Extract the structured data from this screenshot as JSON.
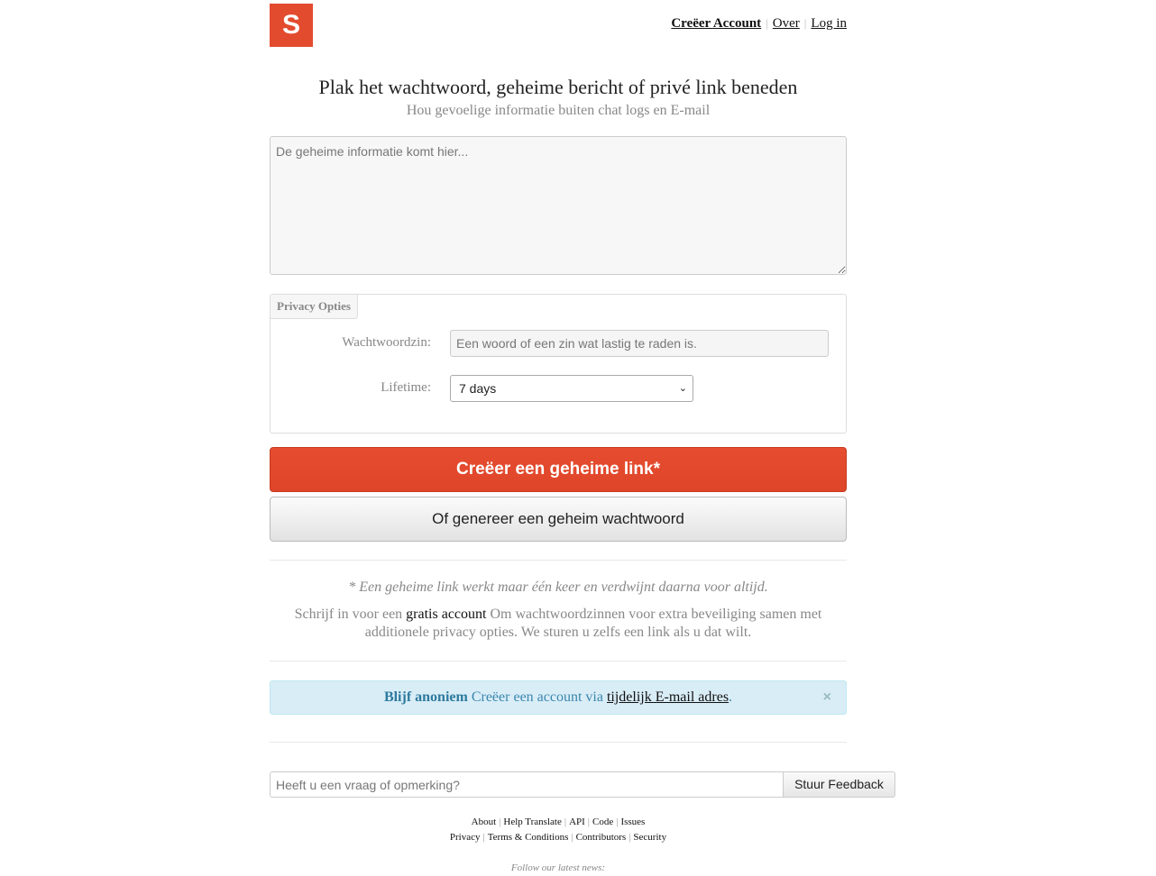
{
  "brand": {
    "logo_letter": "S"
  },
  "topnav": {
    "create_account": "Creëer Account",
    "about": "Over",
    "login": "Log in",
    "separator": "|"
  },
  "hero": {
    "title": "Plak het wachtwoord, geheime bericht of privé link beneden",
    "subtitle": "Hou gevoelige informatie buiten chat logs en E-mail"
  },
  "secret_field": {
    "placeholder": "De geheime informatie komt hier..."
  },
  "privacy_options": {
    "tab_label": "Privacy Opties",
    "passphrase_label": "Wachtwoordzin:",
    "passphrase_placeholder": "Een woord of een zin wat lastig te raden is.",
    "lifetime_label": "Lifetime:",
    "lifetime_value": "7 days"
  },
  "actions": {
    "create_link": "Creëer een geheime link*",
    "generate_password": "Of genereer een geheim wachtwoord"
  },
  "notes": {
    "one_time": "* Een geheime link werkt maar één keer en verdwijnt daarna voor altijd.",
    "signup_prefix": "Schrijf in voor een ",
    "signup_link": "gratis account",
    "signup_suffix": " Om wachtwoordzinnen voor extra beveiliging samen met additionele privacy opties. We sturen u zelfs een link als u dat wilt."
  },
  "alert": {
    "strong": "Blijf anoniem",
    "text": " Creëer een account via ",
    "link": "tijdelijk E-mail adres",
    "end": ".",
    "close": "×"
  },
  "feedback": {
    "placeholder": "Heeft u een vraag of opmerking?",
    "button": "Stuur Feedback"
  },
  "footer": {
    "row1": [
      "About",
      "Help Translate",
      "API",
      "Code",
      "Issues"
    ],
    "row2": [
      "Privacy",
      "Terms & Conditions",
      "Contributors",
      "Security"
    ],
    "follow": "Follow our latest news:"
  },
  "colors": {
    "brand": "#e34b2f",
    "alert_bg": "#d9edf7",
    "alert_text": "#3a87ad"
  }
}
